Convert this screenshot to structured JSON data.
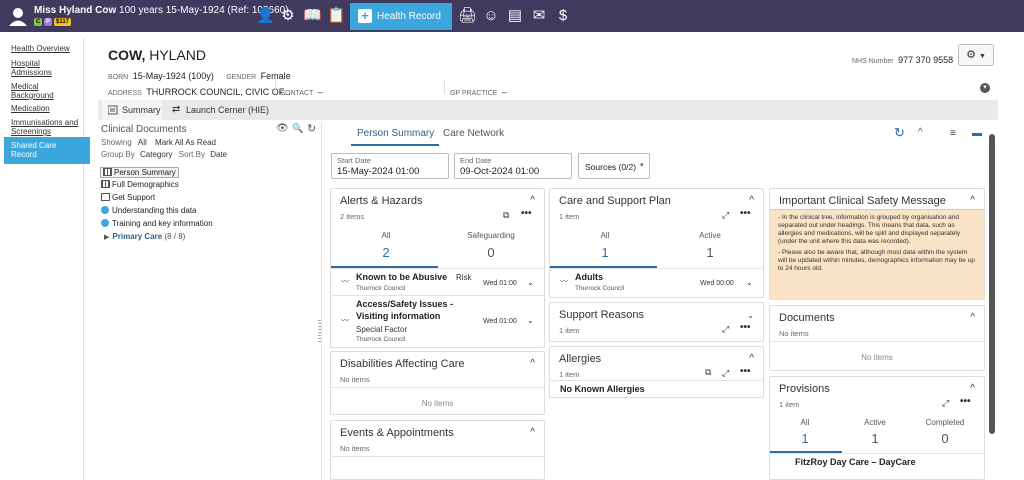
{
  "topbar": {
    "patient_name": "Miss Hyland Cow",
    "patient_info": "100 years 15-May-1924 (Ref: 105660)",
    "badges": [
      "C",
      "P",
      "$117"
    ],
    "health_record_label": "Health Record"
  },
  "leftnav": {
    "items": [
      "Health Overview",
      "Hospital Admissions",
      "Medical Background",
      "Medication",
      "Immunisations and Screenings",
      "Shared Care Record"
    ]
  },
  "patient": {
    "surname": "COW,",
    "forename": "HYLAND",
    "born_label": "BORN",
    "born_value": "15-May-1924 (100y)",
    "gender_label": "GENDER",
    "gender_value": "Female",
    "address_label": "ADDRESS",
    "address_value": "THURROCK COUNCIL, CIVIC OF...",
    "contact_label": "CONTACT",
    "contact_value": "–",
    "gp_label": "GP PRACTICE",
    "gp_value": "–",
    "nhs_label": "NHS Number",
    "nhs_value": "977 370 9558"
  },
  "tabs": {
    "summary": "Summary",
    "cerner": "Launch Cerner (HIE)"
  },
  "clinical_docs": {
    "title": "Clinical Documents",
    "showing_label": "Showing",
    "showing_value": "All",
    "mark_all": "Mark All As Read",
    "group_by_label": "Group By",
    "group_by_value": "Category",
    "sort_by_label": "Sort By",
    "sort_by_value": "Date",
    "items": [
      "Person Summary",
      "Full Demographics",
      "Get Support",
      "Understanding this data",
      "Training and key information"
    ],
    "folder": "Primary Care",
    "folder_count": "(8 / 8)"
  },
  "summary": {
    "tab_person": "Person Summary",
    "tab_network": "Care Network",
    "start_label": "Start Date",
    "start_value": "15-May-2024 01:00",
    "end_label": "End Date",
    "end_value": "09-Oct-2024 01:00",
    "sources": "Sources (0/2)"
  },
  "cards": {
    "alerts": {
      "title": "Alerts & Hazards",
      "count": "2 items",
      "tab_all": "All",
      "tab_all_n": "2",
      "tab_safe": "Safeguarding",
      "tab_safe_n": "0",
      "e1_title": "Known to be Abusive",
      "e1_tag": "Risk",
      "e1_sub": "Thurrock Council",
      "e1_date": "Wed 01:00",
      "e2_title_a": "Access/Safety Issues -",
      "e2_title_b": "Visiting information",
      "e2_tag": "Special Factor",
      "e2_sub": "Thurrock Council",
      "e2_date": "Wed 01:00"
    },
    "disabilities": {
      "title": "Disabilities Affecting Care",
      "count": "No items",
      "none": "No items"
    },
    "events": {
      "title": "Events & Appointments",
      "count": "No items"
    },
    "careplan": {
      "title": "Care and Support Plan",
      "count": "1 item",
      "tab_all": "All",
      "tab_all_n": "1",
      "tab_active": "Active",
      "tab_active_n": "1",
      "e1_title": "Adults",
      "e1_sub": "Thurrock Council",
      "e1_date": "Wed 00:00"
    },
    "reasons": {
      "title": "Support Reasons",
      "count": "1 item"
    },
    "allergies": {
      "title": "Allergies",
      "count": "1 item",
      "entry": "No Known Allergies"
    },
    "safety": {
      "title": "Important Clinical Safety Message",
      "p1": "- In the clinical tree, information is grouped by organisation and separated out under headings. This means that data, such as allergies and medications, will be split and displayed separately (under the unit where this data was recorded).",
      "p2": "- Please also be aware that, although most data within the system will be updated within minutes, demographics information may be up to 24 hours old."
    },
    "documents": {
      "title": "Documents",
      "count": "No items",
      "none": "No items"
    },
    "provisions": {
      "title": "Provisions",
      "count": "1 item",
      "tab_all": "All",
      "tab_all_n": "1",
      "tab_active": "Active",
      "tab_active_n": "1",
      "tab_completed": "Completed",
      "tab_completed_n": "0",
      "partial": "FitzRoy Day Care – DayCare"
    }
  }
}
